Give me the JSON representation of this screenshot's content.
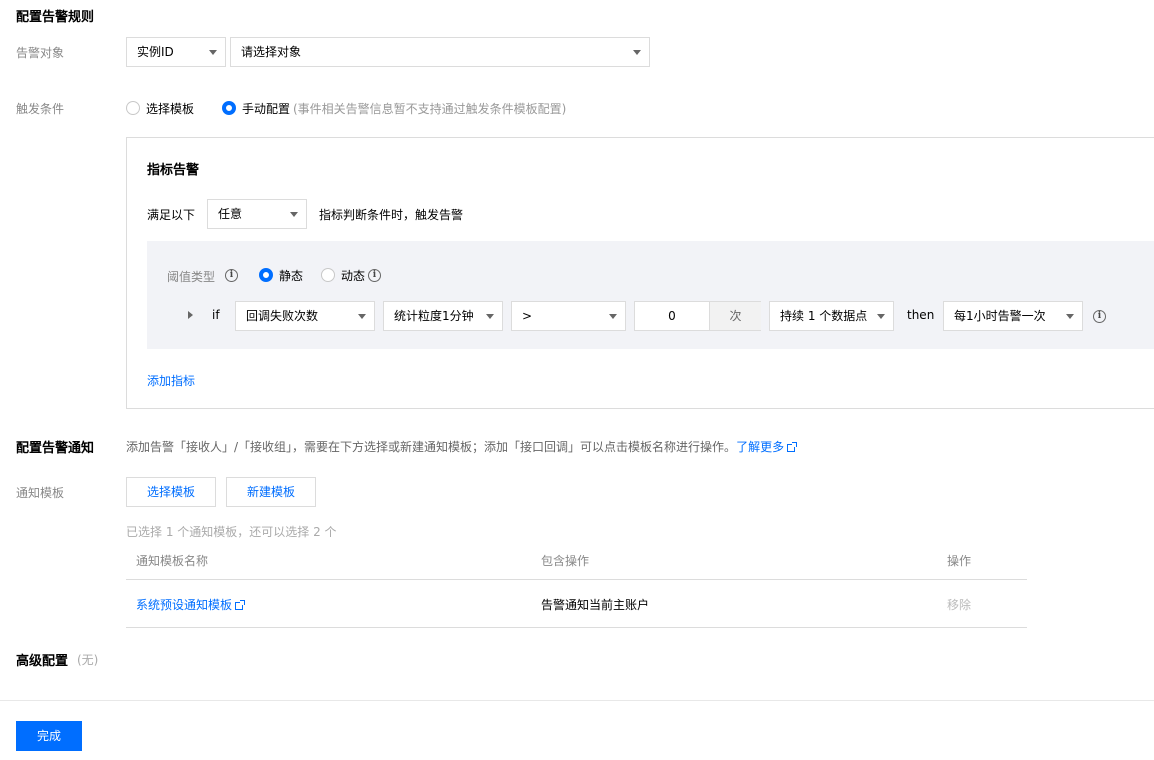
{
  "rule": {
    "title": "配置告警规则",
    "target_label": "告警对象",
    "target_type": "实例ID",
    "target_placeholder": "请选择对象",
    "trigger_label": "触发条件",
    "trigger_template_option": "选择模板",
    "trigger_manual_option": "手动配置",
    "trigger_manual_note": "(事件相关告警信息暂不支持通过触发条件模板配置)"
  },
  "metric": {
    "title": "指标告警",
    "satisfy_prefix": "满足以下",
    "satisfy_value": "任意",
    "satisfy_suffix": "指标判断条件时，触发告警",
    "threshold_label": "阈值类型",
    "threshold_static": "静态",
    "threshold_dynamic": "动态",
    "if_label": "if",
    "metric_name": "回调失败次数",
    "granularity": "统计粒度1分钟",
    "operator": ">",
    "value": "0",
    "unit": "次",
    "duration": "持续 1 个数据点",
    "then_label": "then",
    "frequency": "每1小时告警一次",
    "add_metric": "添加指标"
  },
  "notify": {
    "title": "配置告警通知",
    "description": "添加告警「接收人」/「接收组」，需要在下方选择或新建通知模板；添加「接口回调」可以点击模板名称进行操作。",
    "learn_more": "了解更多",
    "template_label": "通知模板",
    "select_template_btn": "选择模板",
    "new_template_btn": "新建模板",
    "selected_info": "已选择 1 个通知模板，还可以选择 2 个",
    "table": {
      "headers": [
        "通知模板名称",
        "包含操作",
        "操作"
      ],
      "rows": [
        {
          "name": "系统预设通知模板",
          "action": "告警通知当前主账户",
          "op": "移除"
        }
      ]
    }
  },
  "advanced": {
    "title": "高级配置",
    "note": "(无)"
  },
  "finish_btn": "完成",
  "colors": {
    "accent": "#006eff",
    "muted": "#888888",
    "panel_bg": "#f2f3f7"
  }
}
